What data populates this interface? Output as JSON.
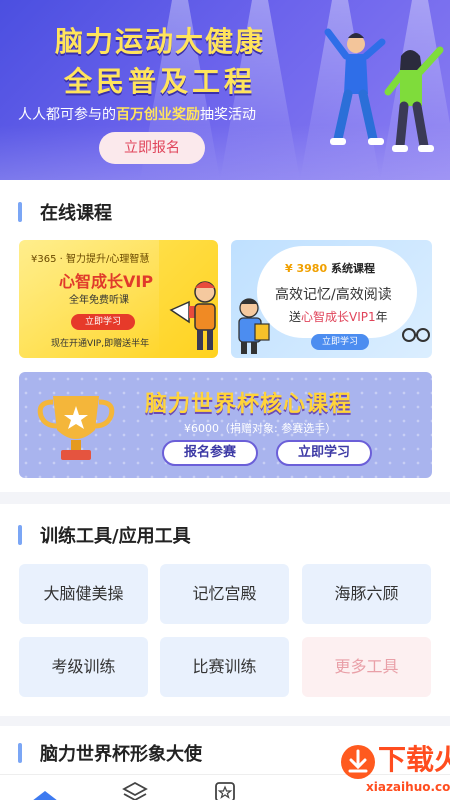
{
  "banner": {
    "title_line1": "脑力运动大健康",
    "title_line2": "全民普及工程",
    "subtitle_pre": "人人都可参与的",
    "subtitle_highlight": "百万创业奖励",
    "subtitle_post": "抽奖活动",
    "cta": "立即报名"
  },
  "online_courses": {
    "title": "在线课程",
    "vip_card": {
      "tag": "¥365 · 智力提升/心理智慧",
      "headline": "心智成长VIP",
      "sub": "全年免费听课",
      "button": "立即学习",
      "note": "现在开通VIP,即赠送半年"
    },
    "system_card": {
      "price": "¥ 3980",
      "label": "系统课程",
      "line1": "高效记忆/高效阅读",
      "line2_pre": "送",
      "line2_highlight": "心智成长VIP1",
      "line2_post": "年",
      "button": "立即学习"
    },
    "worldcup_card": {
      "title": "脑力世界杯核心课程",
      "price": "¥6000（捐赠对象: 参赛选手）",
      "btn_signup": "报名参赛",
      "btn_learn": "立即学习"
    }
  },
  "tools": {
    "title": "训练工具/应用工具",
    "items": [
      "大脑健美操",
      "记忆宫殿",
      "海豚六顾",
      "考级训练",
      "比赛训练",
      "更多工具"
    ]
  },
  "ambassador": {
    "title": "脑力世界杯形象大使"
  },
  "watermark": {
    "brand": "下载火",
    "url": "xiazaihuo.com"
  },
  "colors": {
    "accent": "#7ba6f5",
    "banner_yellow": "#ffe45c",
    "red": "#e0445a"
  }
}
